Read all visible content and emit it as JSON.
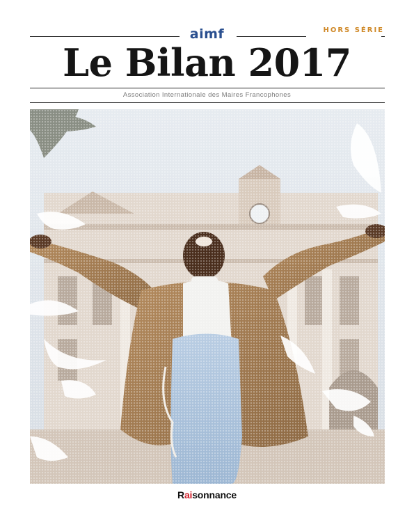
{
  "header": {
    "brand": "aimf",
    "edition_tag": "HORS SÉRIE",
    "title": "Le Bilan 2017",
    "subtitle": "Association Internationale des Maires Francophones"
  },
  "cover_image": {
    "icon": "cover-photo-person-with-doves"
  },
  "footer": {
    "publisher_prefix": "R",
    "publisher_accent": "ai",
    "publisher_suffix": "sonnance"
  },
  "colors": {
    "brand_blue": "#2a4f8f",
    "edition_orange": "#d08a2a",
    "publisher_red": "#d11f2a",
    "title_black": "#151515"
  }
}
